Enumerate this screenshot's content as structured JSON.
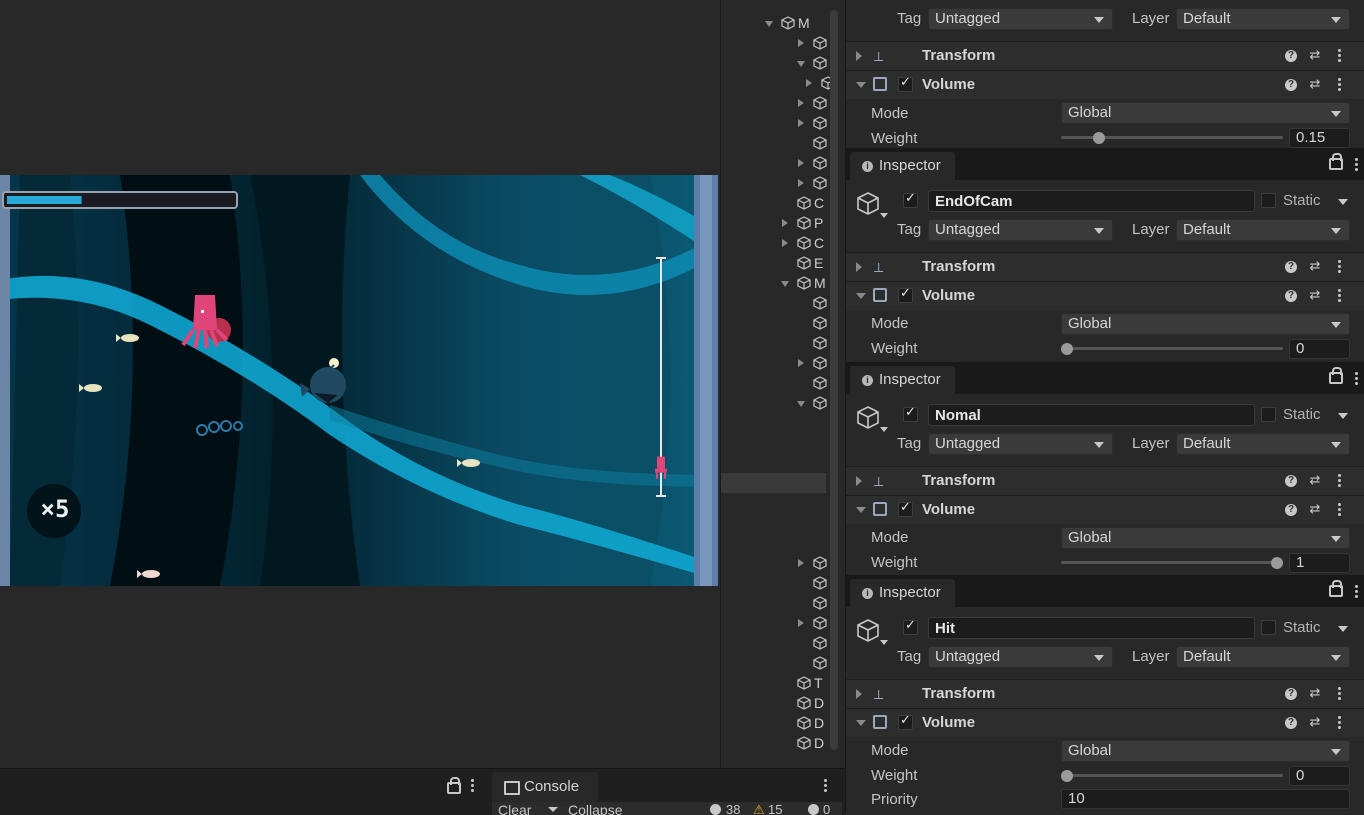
{
  "game": {
    "hp_fraction": 0.33,
    "combo_label": "×5",
    "progress_fraction": 0.88
  },
  "hierarchy": {
    "row_letters": [
      "M",
      "C",
      "P",
      "C",
      "E",
      "M",
      "T",
      "D",
      "D",
      "D"
    ]
  },
  "console": {
    "tab_label": "Console",
    "clear_label": "Clear",
    "collapse_label": "Collapse",
    "info_count": "38",
    "warn_count": "15",
    "error_count": "0"
  },
  "inspector_top": {
    "tag_label": "Tag",
    "tag_value": "Untagged",
    "layer_label": "Layer",
    "layer_value": "Default",
    "transform_title": "Transform",
    "volume_title": "Volume",
    "mode_label": "Mode",
    "mode_value": "Global",
    "weight_label": "Weight",
    "weight_value": "0.15",
    "weight_fraction": 0.15
  },
  "panels": [
    {
      "tab_label": "Inspector",
      "object_name": "EndOfCam",
      "static_label": "Static",
      "tag_label": "Tag",
      "tag_value": "Untagged",
      "layer_label": "Layer",
      "layer_value": "Default",
      "transform_title": "Transform",
      "volume_title": "Volume",
      "mode_label": "Mode",
      "mode_value": "Global",
      "weight_label": "Weight",
      "weight_value": "0",
      "weight_fraction": 0
    },
    {
      "tab_label": "Inspector",
      "object_name": "Nomal",
      "static_label": "Static",
      "tag_label": "Tag",
      "tag_value": "Untagged",
      "layer_label": "Layer",
      "layer_value": "Default",
      "transform_title": "Transform",
      "volume_title": "Volume",
      "mode_label": "Mode",
      "mode_value": "Global",
      "weight_label": "Weight",
      "weight_value": "1",
      "weight_fraction": 1
    },
    {
      "tab_label": "Inspector",
      "object_name": "Hit",
      "static_label": "Static",
      "tag_label": "Tag",
      "tag_value": "Untagged",
      "layer_label": "Layer",
      "layer_value": "Default",
      "transform_title": "Transform",
      "volume_title": "Volume",
      "mode_label": "Mode",
      "mode_value": "Global",
      "weight_label": "Weight",
      "weight_value": "0",
      "weight_fraction": 0,
      "priority_label": "Priority",
      "priority_value": "10"
    }
  ],
  "colors": {
    "editor_bg": "#282828",
    "water": "#05303f",
    "ribbon": "#0fa6d0",
    "squid": "#e0457a",
    "hp_fill": "#2aa8d8"
  }
}
